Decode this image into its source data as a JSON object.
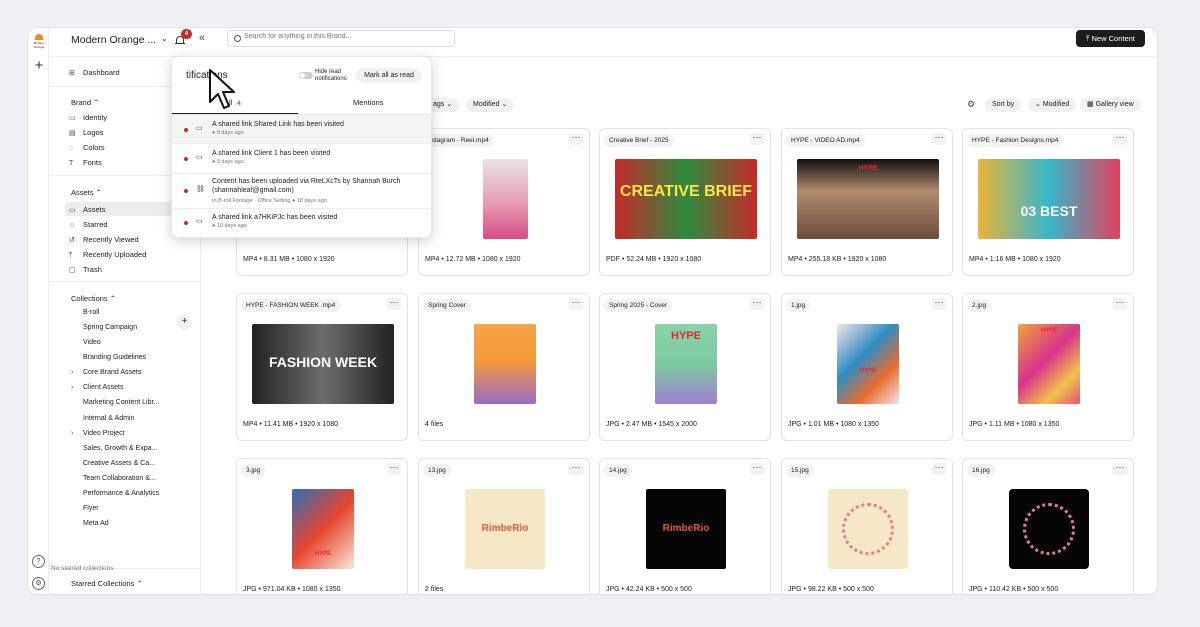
{
  "topbar": {
    "brand_name": "Modern Orange ...",
    "notification_count": "4",
    "search_placeholder": "Search for anything in this Brand...",
    "new_content_label": "New Content"
  },
  "rail": {
    "logo_text": "Modern Orange"
  },
  "sidebar": {
    "dashboard": "Dashboard",
    "brand_heading": "Brand",
    "brand_items": [
      "Identity",
      "Logos",
      "Colors",
      "Fonts"
    ],
    "assets_heading": "Assets",
    "assets_items": [
      "Assets",
      "Starred",
      "Recently Viewed",
      "Recently Uploaded",
      "Trash"
    ],
    "collections_heading": "Collections",
    "collections": [
      "B-roll",
      "Spring Campaign",
      "Video",
      "Branding Guidelines",
      "Core Brand Assets",
      "Client Assets",
      "Marketing Content Libr...",
      "Internal & Admin",
      "Video Project",
      "Sales, Growth & Expa...",
      "Creative Assets & Ca...",
      "Team Collaboration &...",
      "Performance & Analytics",
      "Flyer",
      "Meta Ad"
    ],
    "starred_heading": "Starred Collections",
    "no_starred": "No starred collections"
  },
  "toolbar": {
    "tags": "ags",
    "modified_filter": "Modified",
    "sort_by": "Sort by",
    "modified_sort": "Modified",
    "gallery_view": "Gallery view"
  },
  "cards": [
    {
      "name": "",
      "meta": "MP4 • 8.31 MB • 1080 x 1920"
    },
    {
      "name": "nstagram - Reel.mp4",
      "meta": "MP4 • 12.72 MB • 1080 x 1920"
    },
    {
      "name": "Creative Brief - 2025",
      "meta": "PDF • 52.24 MB • 1920 x 1080",
      "thumb_text": "CREATIVE BRIEF"
    },
    {
      "name": "HYPE - VIDEO AD.mp4",
      "meta": "MP4 • 255.18 KB • 1920 x 1080",
      "thumb_text": "HYPE"
    },
    {
      "name": "HYPE - Fashion Designs.mp4",
      "meta": "MP4 • 1.16 MB • 1080 x 1920",
      "thumb_text": "03 BEST"
    },
    {
      "name": "HYPE - FASHION WEEK .mp4",
      "meta": "MP4 • 11.41 MB • 1920 x 1080",
      "thumb_text": "FASHION WEEK"
    },
    {
      "name": "Spring Cover",
      "meta": "4 files"
    },
    {
      "name": "Spring 2025 - Cover",
      "meta": "JPG • 2.47 MB • 1545 x 2000",
      "thumb_text": "HYPE"
    },
    {
      "name": "1.jpg",
      "meta": "JPG • 1.01 MB • 1080 x 1350",
      "thumb_text": "HYPE"
    },
    {
      "name": "2.jpg",
      "meta": "JPG • 1.11 MB • 1080 x 1350",
      "thumb_text": "HYPE"
    },
    {
      "name": "3.jpg",
      "meta": "JPG • 971.04 KB • 1080 x 1350",
      "thumb_text": "HYPE"
    },
    {
      "name": "13.jpg",
      "meta": "2 files",
      "thumb_text": "RimbeRio"
    },
    {
      "name": "14.jpg",
      "meta": "JPG • 42.24 KB • 500 x 500",
      "thumb_text": "RimbeRio"
    },
    {
      "name": "15.jpg",
      "meta": "JPG • 98.22 KB • 500 x 500",
      "thumb_text": "RimbeRio"
    },
    {
      "name": "16.jpg",
      "meta": "JPG • 110.42 KB • 500 x 500",
      "thumb_text": "RimbeRio"
    }
  ],
  "notifications": {
    "title": "tifications",
    "hide_read_label": "Hide read notifications",
    "mark_all_label": "Mark all as read",
    "tab_all": "All",
    "tab_all_count": "4",
    "tab_mentions": "Mentions",
    "items": [
      {
        "message": "A shared link Shared Link has been visited",
        "sub": "● 5 days ago"
      },
      {
        "message": "A shared link Client 1 has been visited",
        "sub": "● 5 days ago"
      },
      {
        "message": "Content has been uploaded via RteLXcTs by Shannah Burch (shannahleaf@gmail.com)",
        "sub": "In B-roll Footage - Office Setting ● 18 days ago"
      },
      {
        "message": "A shared link a7HKiPJc has been visited",
        "sub": "● 19 days ago"
      }
    ]
  },
  "colors": {
    "accent_dark": "#1c1c1c",
    "unread_dot": "#c62828",
    "badge": "#c62828"
  }
}
